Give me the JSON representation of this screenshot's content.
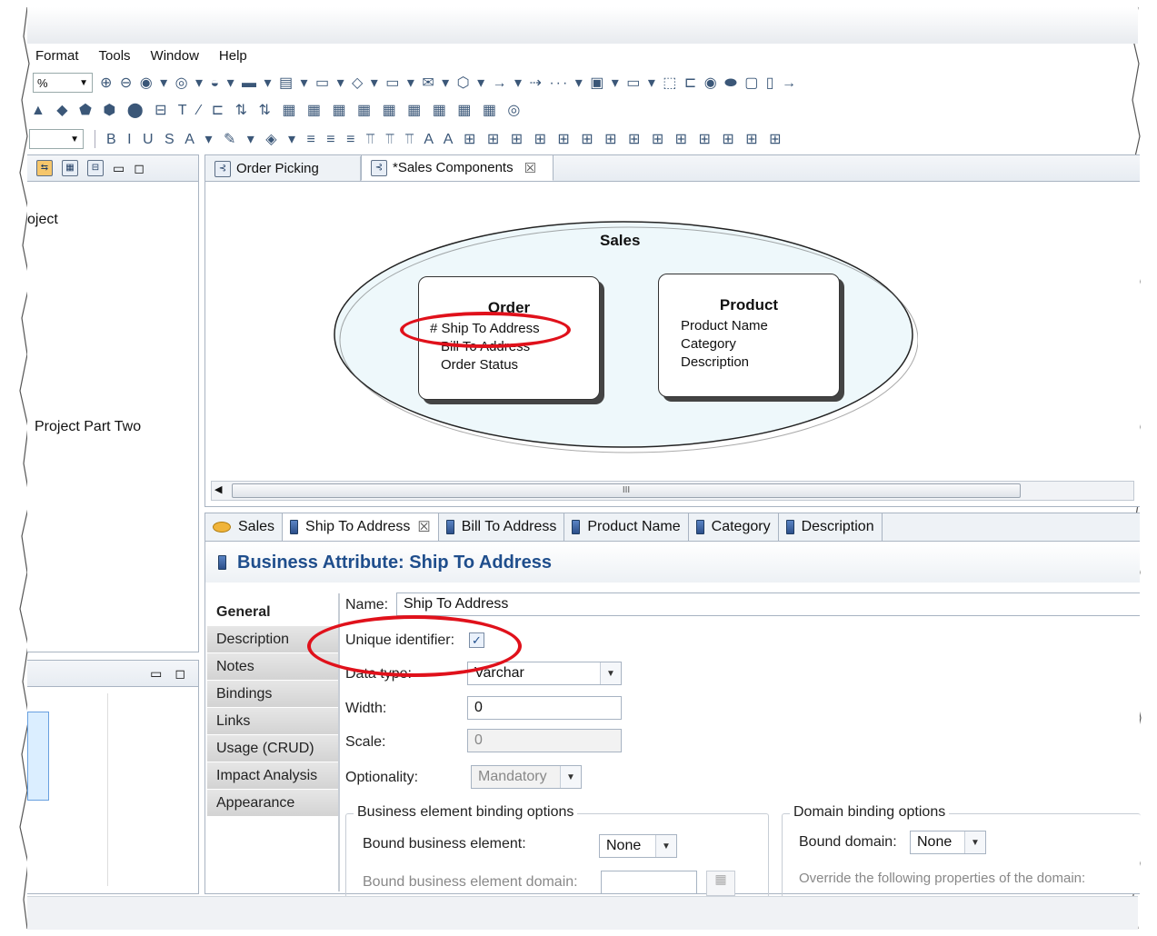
{
  "menu": [
    "Format",
    "Tools",
    "Window",
    "Help"
  ],
  "toolbar": {
    "zoom_value": "%",
    "row1_glyphs": "⊕ ⊖ ◉ ▾ ◎ ▾ ◒ ▾ ▬ ▾ ▤ ▾ ▭ ▾ ◇ ▾ ▭ ▾ ✉ ▾ ⬡ ▾ → ▾ ⇢ ··· ▾ ▣ ▾ ▭ ▾ ⬚ ⊏ ◉ ⬬ ▢ ▯ →",
    "row2_glyphs": "▲ ◆ ⬟ ⬢ ⬤ ⊟ T ⁄ ⊏ ⇅ ⇅ ▦ ▦ ▦ ▦ ▦ ▦ ▦ ▦ ▦ ◎",
    "row3_glyphs": "B I U S A ▾ ✎ ▾ ◈ ▾ ≡ ≡ ≡ ⫪ ⫪ ⫪ A A ⊞ ⊞ ⊞ ⊞ ⊞ ⊞ ⊞ ⊞ ⊞ ⊞ ⊞ ⊞ ⊞ ⊞"
  },
  "left_panel": {
    "item_project": "oject",
    "item_project_two": "Project Part Two"
  },
  "editor_tabs": [
    {
      "label": "Order Picking"
    },
    {
      "label": "*Sales Components"
    }
  ],
  "diagram": {
    "subject_area": "Sales",
    "order": {
      "title": "Order",
      "attrs": [
        "# Ship To Address",
        "Bill To Address",
        "Order Status"
      ]
    },
    "product": {
      "title": "Product",
      "attrs": [
        "Product Name",
        "Category",
        "Description"
      ]
    }
  },
  "scroll_grip": "III",
  "bottom_tabs": [
    "Sales",
    "Ship To Address",
    "Bill To Address",
    "Product Name",
    "Category",
    "Description"
  ],
  "properties": {
    "header": "Business Attribute: Ship To Address",
    "side_tabs": [
      "General",
      "Description",
      "Notes",
      "Bindings",
      "Links",
      "Usage (CRUD)",
      "Impact Analysis",
      "Appearance"
    ],
    "name_label": "Name:",
    "name_value": "Ship To Address",
    "unique_label": "Unique identifier:",
    "unique_checked": true,
    "datatype_label": "Data type:",
    "datatype_value": "Varchar",
    "width_label": "Width:",
    "width_value": "0",
    "scale_label": "Scale:",
    "scale_value": "0",
    "optionality_label": "Optionality:",
    "optionality_value": "Mandatory",
    "bel_group": "Business element binding options",
    "bound_be_label": "Bound business element:",
    "bound_be_value": "None",
    "bound_be_domain_label": "Bound business element domain:",
    "domain_group": "Domain binding options",
    "bound_domain_label": "Bound domain:",
    "bound_domain_value": "None",
    "override_text": "Override the following properties of the domain:"
  },
  "colors": {
    "accent": "#1f4e8c",
    "highlight": "#e0111b"
  }
}
